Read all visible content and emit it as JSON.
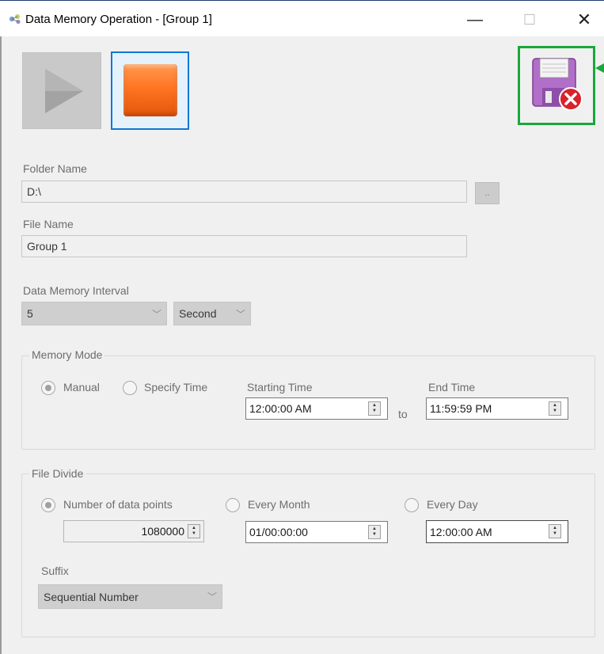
{
  "window": {
    "title": "Data Memory Operation - [Group 1]",
    "app_icon": "molecule-icon",
    "minimize": "—",
    "maximize": "☐",
    "close": "✕"
  },
  "toolbar": {
    "start_icon": "play-icon",
    "stop_icon": "stop-icon",
    "save_cancel_icon": "floppy-disk-cancel-icon"
  },
  "folder": {
    "label": "Folder Name",
    "value": "D:\\",
    "browse_label": ".."
  },
  "file": {
    "label": "File Name",
    "value": "Group 1"
  },
  "interval": {
    "label": "Data Memory Interval",
    "value": "5",
    "unit": "Second"
  },
  "memory_mode": {
    "legend": "Memory Mode",
    "manual_label": "Manual",
    "specify_label": "Specify Time",
    "selected": "Manual",
    "start_label": "Starting Time",
    "start_value": "12:00:00 AM",
    "to_label": "to",
    "end_label": "End Time",
    "end_value": "11:59:59 PM"
  },
  "file_divide": {
    "legend": "File Divide",
    "points_label": "Number of data points",
    "points_value": "1080000",
    "month_label": "Every Month",
    "month_value": "01/00:00:00",
    "day_label": "Every Day",
    "day_value": "12:00:00 AM",
    "selected": "Number of data points",
    "suffix_label": "Suffix",
    "suffix_value": "Sequential Number"
  },
  "colors": {
    "highlight": "#18a83a",
    "stop_orange": "#ff7522",
    "focus_blue": "#0b78d7"
  }
}
